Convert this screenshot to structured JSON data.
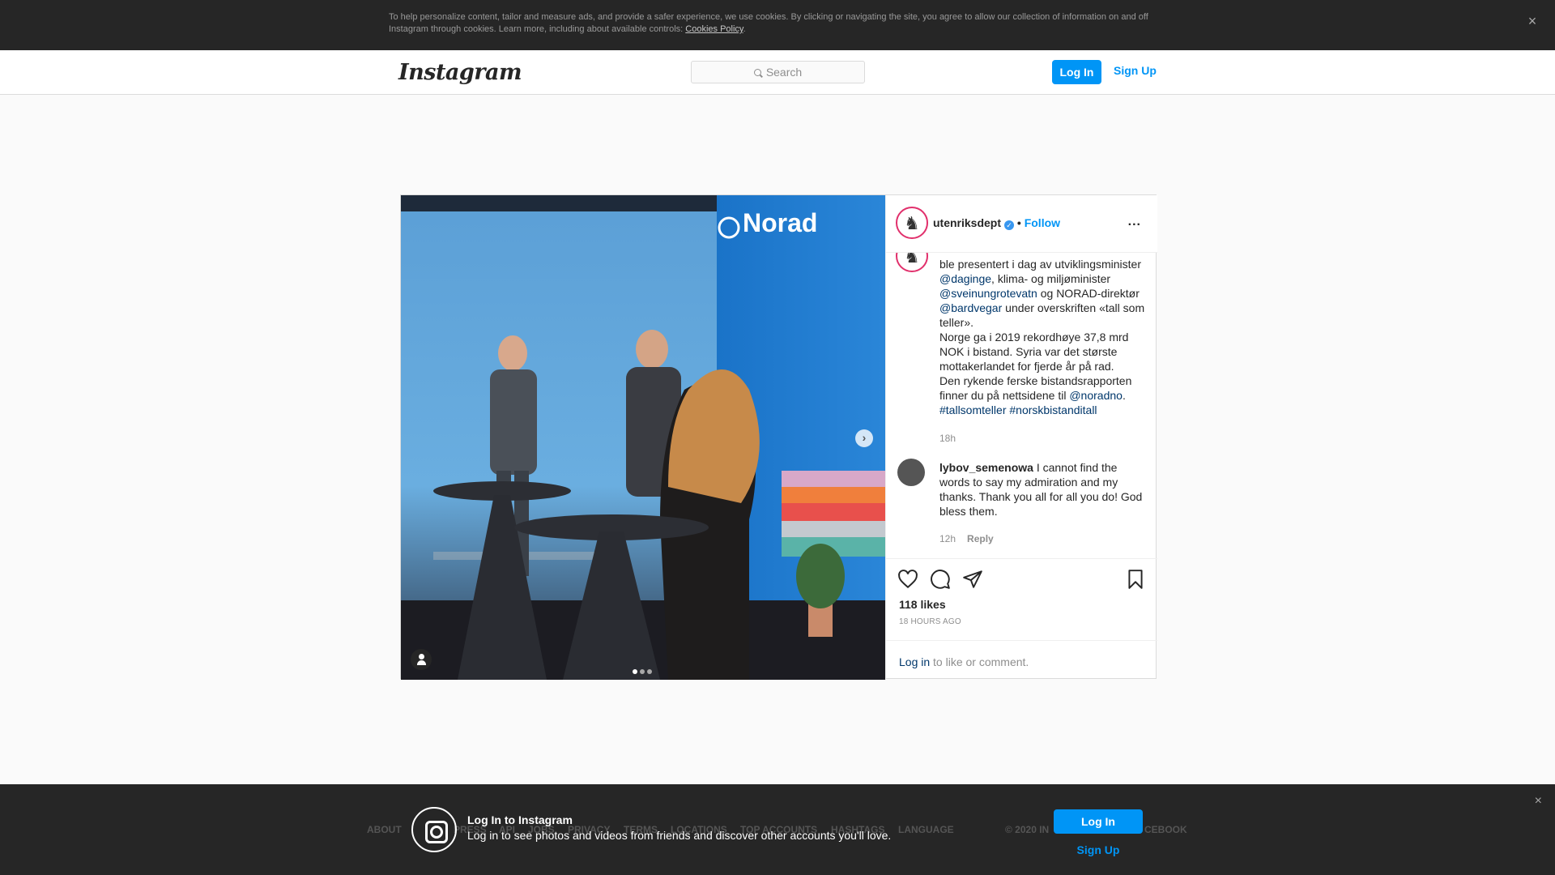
{
  "cookie": {
    "text": "To help personalize content, tailor and measure ads, and provide a safer experience, we use cookies. By clicking or navigating the site, you agree to allow our collection of information on and off Instagram through cookies. Learn more, including about available controls: ",
    "link": "Cookies Policy",
    "trailing": ".",
    "close": "×"
  },
  "nav": {
    "logo": "Instagram",
    "search_placeholder": "Search",
    "login": "Log In",
    "signup": "Sign Up"
  },
  "post": {
    "username": "utenriksdept",
    "verified": "✓",
    "separator": " • ",
    "follow": "Follow",
    "more": "...",
    "caption": [
      {
        "t": "ble presentert i dag av utviklingsminister ",
        "m": false
      },
      {
        "t": "@daginge",
        "m": true
      },
      {
        "t": ", klima- og miljøminister ",
        "m": false
      },
      {
        "t": "@sveinungrotevatn",
        "m": true
      },
      {
        "t": " og NORAD-direktør ",
        "m": false
      },
      {
        "t": "@bardvegar",
        "m": true
      },
      {
        "t": " under overskriften «tall som teller».",
        "m": false
      }
    ],
    "caption_p2": "Norge ga i 2019 rekordhøye 37,8 mrd NOK i bistand. Syria var det største mottakerlandet for fjerde år på rad.",
    "caption_p3_pre": "Den rykende ferske bistandsrapporten finner du på nettsidene til ",
    "caption_p3_mention": "@noradno",
    "caption_p3_post": ".",
    "hashtags": [
      "#tallsomteller",
      "#norskbistanditall"
    ],
    "caption_time": "18h",
    "comment": {
      "user": "lybov_semenowa",
      "text": " I cannot find the words to say my admiration and my thanks. Thank you all for all you do! God bless them.",
      "time": "12h",
      "reply": "Reply"
    },
    "likes": "118 likes",
    "ago": "18 HOURS AGO",
    "login_link": "Log in",
    "login_rest": " to like or comment.",
    "photo_brand": "Norad",
    "carousel_index": 1,
    "carousel_total": 3
  },
  "footer": {
    "links": [
      "ABOUT",
      "PRESS",
      "API",
      "JOBS",
      "PRIVACY",
      "TERMS",
      "LOCATIONS",
      "TOP ACCOUNTS",
      "HASHTAGS",
      "LANGUAGE"
    ],
    "copyright_left": "© 2020 IN",
    "copyright_right": "CEBOOK"
  },
  "bottom_bar": {
    "title": "Log In to Instagram",
    "subtitle": "Log in to see photos and videos from friends and discover other accounts you'll love.",
    "login": "Log In",
    "signup": "Sign Up",
    "close": "×"
  },
  "colors": {
    "accent": "#0095f6",
    "mention": "#00376b",
    "dark": "#262626"
  }
}
